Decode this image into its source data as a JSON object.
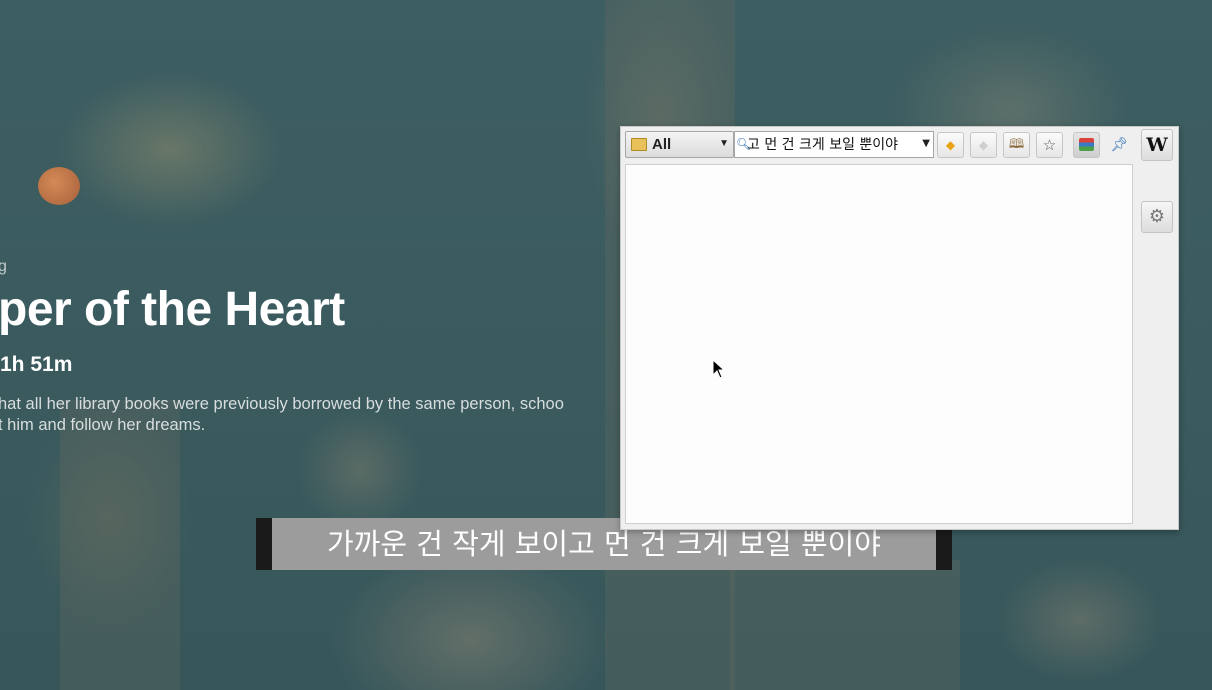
{
  "hero": {
    "kicker": "g",
    "title": "per of the Heart",
    "runtime": "1h 51m",
    "description_line1": "hat all her library books were previously borrowed by the same person, schoo",
    "description_line2": "t him and follow her dreams."
  },
  "subtitle": {
    "text": "가까운 건 작게 보이고 먼 건 크게 보일 뿐이야"
  },
  "popup": {
    "dictionary_select": "All",
    "search_value": "고 먼 건 크게 보일 뿐이야",
    "toolbar_icons": [
      "back-icon",
      "forward-icon",
      "book-icon",
      "star-icon",
      "books-icon",
      "pin-icon"
    ],
    "sidebar": {
      "wikipedia_label": "W",
      "icons": [
        "wikipedia-icon",
        "globe-icon",
        "gear-icon"
      ]
    }
  },
  "colors": {
    "accent_orange": "#e8a317",
    "subtitle_bg": "#9c9c9c"
  }
}
